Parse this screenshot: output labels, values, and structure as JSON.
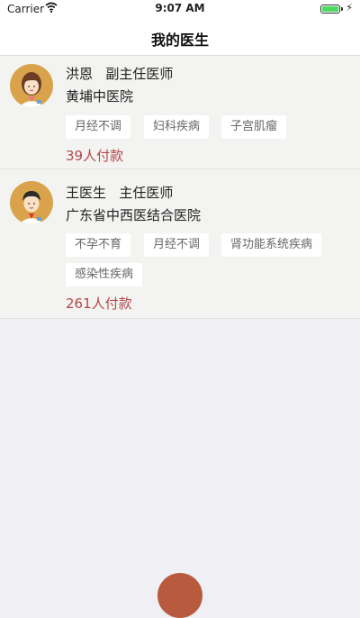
{
  "status_bar": {
    "carrier": "Carrier",
    "time": "9:07 AM",
    "charging_symbol": "⚡",
    "battery_level": 1.0,
    "icons": [
      "wifi-icon",
      "battery-icon"
    ]
  },
  "nav": {
    "title": "我的医生"
  },
  "doctors": [
    {
      "name": "洪恩",
      "title": "副主任医师",
      "hospital": "黄埔中医院",
      "tags": [
        "月经不调",
        "妇科疾病",
        "子宫肌瘤"
      ],
      "paid": "39人付款",
      "avatar": "female-doctor-avatar"
    },
    {
      "name": "王医生",
      "title": "主任医师",
      "hospital": "广东省中西医结合医院",
      "tags": [
        "不孕不育",
        "月经不调",
        "肾功能系统疾病",
        "感染性疾病"
      ],
      "paid": "261人付款",
      "avatar": "male-doctor-avatar"
    }
  ],
  "colors": {
    "background": "#efeff4",
    "card": "#f3f3f1",
    "paid_text": "#b4474a",
    "avatar_bg": "#d9a34b",
    "bottom_button": "#b85a3e"
  }
}
